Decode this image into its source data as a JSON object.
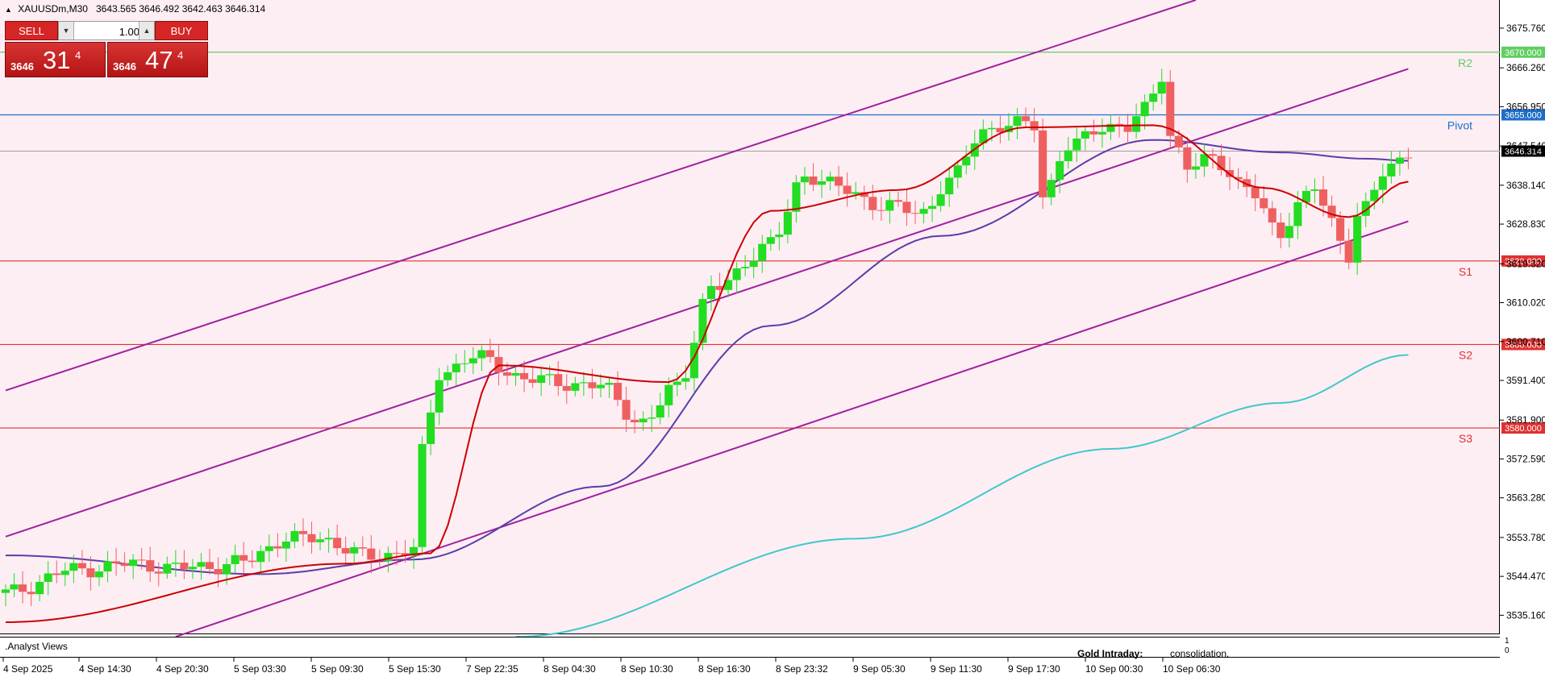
{
  "header": {
    "symbol_info": "XAUUSDm,M30",
    "ohlc": "3643.565 3646.492 3642.463 3646.314"
  },
  "trade_panel": {
    "sell_label": "SELL",
    "buy_label": "BUY",
    "lot_value": "1.00",
    "sell_price_small": "3646",
    "sell_price_big": "31",
    "sell_price_sup": "4",
    "buy_price_small": "3646",
    "buy_price_big": "47",
    "buy_price_sup": "4"
  },
  "analyst_bar": {
    "label": ".Analyst Views",
    "gold_intraday": "Gold Intraday:",
    "text": "consolidation."
  },
  "sub_window_scale": [
    "1",
    "0"
  ],
  "chart_data": {
    "type": "candlestick",
    "symbol": "XAUUSDm",
    "timeframe": "M30",
    "current_price": 3646.314,
    "ylim": [
      3530.6,
      3682.5
    ],
    "y_ticks": [
      "3675.760",
      "3666.260",
      "3656.950",
      "3647.540",
      "3638.140",
      "3628.830",
      "3619.320",
      "3610.020",
      "3600.710",
      "3591.400",
      "3581.900",
      "3572.590",
      "3563.280",
      "3553.780",
      "3544.470",
      "3535.160"
    ],
    "x_ticks": [
      "4 Sep 2025",
      "4 Sep 14:30",
      "4 Sep 20:30",
      "5 Sep 03:30",
      "5 Sep 09:30",
      "5 Sep 15:30",
      "7 Sep 22:35",
      "8 Sep 04:30",
      "8 Sep 10:30",
      "8 Sep 16:30",
      "8 Sep 23:32",
      "9 Sep 05:30",
      "9 Sep 11:30",
      "9 Sep 17:30",
      "10 Sep 00:30",
      "10 Sep 06:30"
    ],
    "levels": [
      {
        "name": "R2",
        "price": 3670.0,
        "label": "3670.000",
        "color": "#5fcf5f"
      },
      {
        "name": "Pivot",
        "price": 3655.0,
        "label": "3655.000",
        "color": "#1e6ec8"
      },
      {
        "name": "S1",
        "price": 3620.0,
        "label": "3620.000",
        "color": "#e03030"
      },
      {
        "name": "S2",
        "price": 3600.0,
        "label": "3600.000",
        "color": "#e03030"
      },
      {
        "name": "S3",
        "price": 3580.0,
        "label": "3580.000",
        "color": "#e03030"
      }
    ],
    "current_price_label": "3646.314",
    "channel": [
      {
        "start": [
          0,
          3589.0
        ],
        "end": [
          140,
          3682.5
        ]
      },
      {
        "start": [
          0,
          3554.0
        ],
        "end": [
          165,
          3666.0
        ]
      },
      {
        "start": [
          20,
          3530.0
        ],
        "end": [
          165,
          3629.5
        ]
      }
    ],
    "ma_fast_anchor": [
      [
        0,
        3533.5
      ],
      [
        40,
        3547.5
      ],
      [
        50,
        3550.0
      ],
      [
        58,
        3595.0
      ],
      [
        78,
        3591.0
      ],
      [
        90,
        3632.0
      ],
      [
        105,
        3637.0
      ],
      [
        120,
        3652.0
      ],
      [
        135,
        3652.5
      ],
      [
        148,
        3637.5
      ],
      [
        158,
        3630.5
      ],
      [
        165,
        3639.0
      ]
    ],
    "ma_mid_anchor": [
      [
        0,
        3549.5
      ],
      [
        30,
        3545.0
      ],
      [
        48,
        3548.5
      ],
      [
        70,
        3566.0
      ],
      [
        90,
        3604.5
      ],
      [
        110,
        3626.0
      ],
      [
        135,
        3649.0
      ],
      [
        150,
        3646.0
      ],
      [
        160,
        3644.5
      ],
      [
        165,
        3644.0
      ]
    ],
    "ma_slow_anchor": [
      [
        60,
        3530.0
      ],
      [
        100,
        3553.5
      ],
      [
        130,
        3575.0
      ],
      [
        150,
        3586.0
      ],
      [
        165,
        3597.5
      ]
    ],
    "candle_anchor": [
      [
        0,
        3540.5
      ],
      [
        8,
        3546.0
      ],
      [
        15,
        3547.5
      ],
      [
        20,
        3546.5
      ],
      [
        25,
        3547.0
      ],
      [
        28,
        3548.0
      ],
      [
        33,
        3553.5
      ],
      [
        37,
        3553.5
      ],
      [
        43,
        3549.0
      ],
      [
        48,
        3551.0
      ],
      [
        49,
        3574.0
      ],
      [
        51,
        3593.0
      ],
      [
        55,
        3597.0
      ],
      [
        62,
        3591.5
      ],
      [
        70,
        3590.0
      ],
      [
        75,
        3581.0
      ],
      [
        79,
        3590.5
      ],
      [
        83,
        3613.0
      ],
      [
        90,
        3624.0
      ],
      [
        94,
        3640.5
      ],
      [
        99,
        3637.0
      ],
      [
        103,
        3633.0
      ],
      [
        108,
        3632.0
      ],
      [
        111,
        3639.0
      ],
      [
        115,
        3651.5
      ],
      [
        121,
        3653.0
      ],
      [
        122,
        3636.0
      ],
      [
        125,
        3647.0
      ],
      [
        129,
        3652.5
      ],
      [
        132,
        3651.5
      ],
      [
        134,
        3656.5
      ],
      [
        136,
        3665.0
      ],
      [
        137,
        3650.0
      ],
      [
        139,
        3642.0
      ],
      [
        142,
        3645.0
      ],
      [
        146,
        3637.0
      ],
      [
        150,
        3627.0
      ],
      [
        152,
        3633.0
      ],
      [
        154,
        3637.5
      ],
      [
        156,
        3629.5
      ],
      [
        158,
        3621.5
      ],
      [
        159,
        3630.5
      ],
      [
        163,
        3643.0
      ],
      [
        165,
        3646.3
      ]
    ],
    "colors": {
      "up": "#22dd22",
      "down": "#ee6060",
      "ma_fast": "#cc0000",
      "ma_mid": "#5a3da8",
      "ma_slow": "#40c8c8",
      "channel": "#a020a0",
      "background": "#fdeef4"
    }
  }
}
